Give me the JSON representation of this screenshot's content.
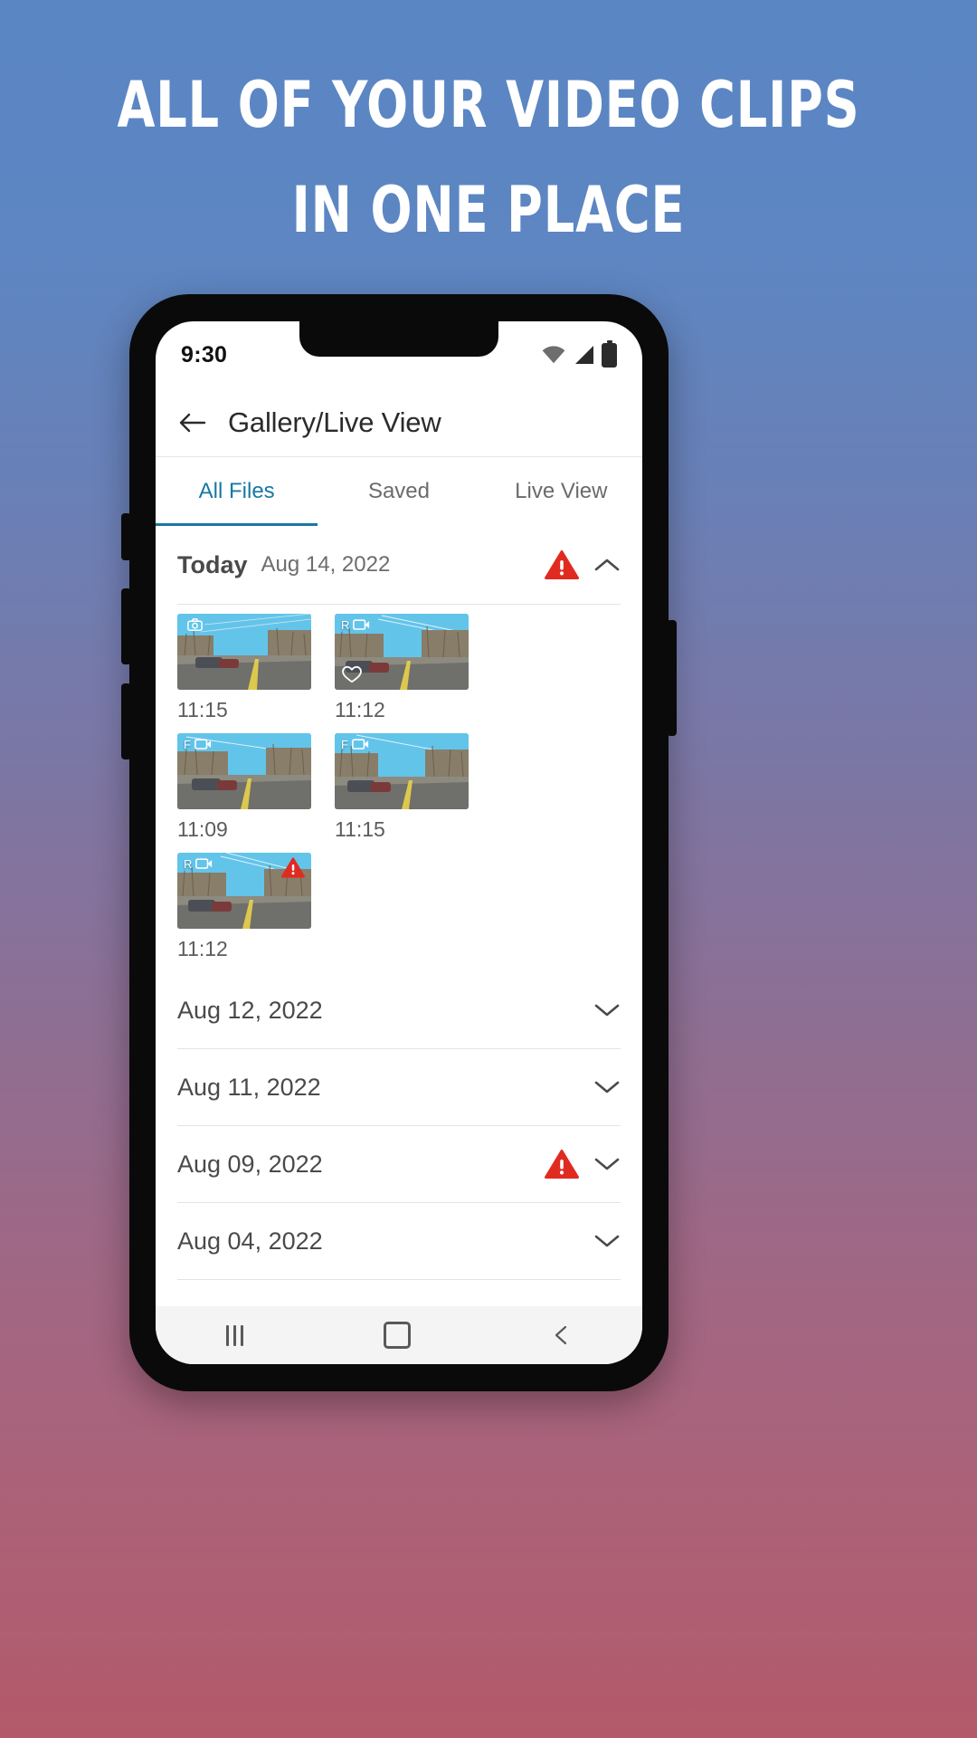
{
  "promo": {
    "line1": "ALL OF YOUR VIDEO CLIPS",
    "line2": "IN ONE PLACE",
    "text_color": "#ffffff",
    "bg_top_color": "#5a86c4",
    "bg_bottom_color": "#b4596a"
  },
  "status_bar": {
    "time": "9:30",
    "icons": [
      "wifi-icon",
      "cellular-signal-icon",
      "battery-icon"
    ]
  },
  "app_bar": {
    "back_icon": "arrow-left-icon",
    "title": "Gallery/Live View"
  },
  "tabs": {
    "active_index": 0,
    "accent_color": "#1878a3",
    "items": [
      {
        "label": "All Files"
      },
      {
        "label": "Saved"
      },
      {
        "label": "Live View"
      }
    ]
  },
  "alert_color": "#e02b20",
  "today_group": {
    "title": "Today",
    "date": "Aug 14, 2022",
    "has_alert": true,
    "alert_icon": "alert-triangle-icon",
    "expanded": true,
    "chevron_icon": "chevron-up-icon",
    "clips": [
      {
        "badge_text": "",
        "badge_icon": "camera-icon",
        "time": "11:15",
        "saved": false,
        "alert": false
      },
      {
        "badge_text": "R",
        "badge_icon": "video-camera-icon",
        "time": "11:12",
        "saved": true,
        "alert": false
      },
      {
        "badge_text": "F",
        "badge_icon": "video-camera-icon",
        "time": "11:09",
        "saved": false,
        "alert": false
      },
      {
        "badge_text": "F",
        "badge_icon": "video-camera-icon",
        "time": "11:15",
        "saved": false,
        "alert": false
      },
      {
        "badge_text": "R",
        "badge_icon": "video-camera-icon",
        "time": "11:12",
        "saved": false,
        "alert": true
      }
    ]
  },
  "date_groups": [
    {
      "label": "Aug 12, 2022",
      "has_alert": false,
      "chevron_icon": "chevron-down-icon"
    },
    {
      "label": "Aug 11, 2022",
      "has_alert": false,
      "chevron_icon": "chevron-down-icon"
    },
    {
      "label": "Aug 09, 2022",
      "has_alert": true,
      "chevron_icon": "chevron-down-icon"
    },
    {
      "label": "Aug 04, 2022",
      "has_alert": false,
      "chevron_icon": "chevron-down-icon"
    }
  ],
  "system_nav": {
    "recents_icon": "recents-icon",
    "home_icon": "home-icon",
    "back_icon": "chevron-left-icon"
  }
}
